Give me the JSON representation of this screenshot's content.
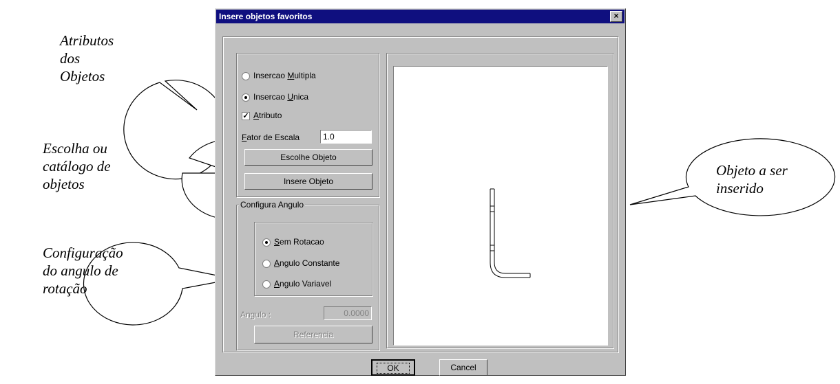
{
  "callouts": {
    "atributos": "Atributos\ndos\nObjetos",
    "escolha": "Escolha  ou\ncatálogo de\nobjetos",
    "configuracao": "Configuração\ndo angulo de\nrotação",
    "objeto": "Objeto a ser\ninserido"
  },
  "dialog": {
    "title": "Insere objetos favoritos",
    "close_label": "×",
    "insert_options": {
      "multipla": {
        "pre": "Insercao ",
        "key": "M",
        "post": "ultipla",
        "selected": false
      },
      "unica": {
        "pre": "Insercao ",
        "key": "U",
        "post": "nica",
        "selected": true
      },
      "atributo": {
        "key": "A",
        "post": "tributo",
        "checked": true,
        "mark": "✓"
      }
    },
    "scale": {
      "key": "F",
      "post": "ator de Escala",
      "value": "1.0"
    },
    "escolhe_button": "Escolhe Objeto",
    "insere_button": "Insere Objeto",
    "angle_group": {
      "legend": "Configura Angulo",
      "sem": {
        "key": "S",
        "post": "em Rotacao",
        "selected": true
      },
      "constante": {
        "key": "A",
        "post": "ngulo Constante",
        "selected": false
      },
      "variavel": {
        "key": "A",
        "post": "ngulo Variavel",
        "selected": false
      },
      "angulo_label": "Angulo :",
      "angulo_value": "0.0000",
      "referencia_button": "Referencia"
    },
    "ok_button": "OK",
    "cancel_button": "Cancel"
  }
}
